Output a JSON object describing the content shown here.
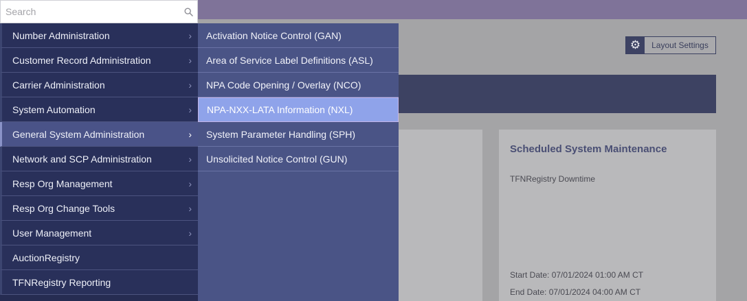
{
  "search": {
    "placeholder": "Search",
    "value": ""
  },
  "menu": {
    "items": [
      {
        "label": "Number Administration",
        "chevron": true
      },
      {
        "label": "Customer Record Administration",
        "chevron": true
      },
      {
        "label": "Carrier Administration",
        "chevron": true
      },
      {
        "label": "System Automation",
        "chevron": true
      },
      {
        "label": "General System Administration",
        "chevron": true,
        "active": true
      },
      {
        "label": "Network and SCP Administration",
        "chevron": true
      },
      {
        "label": "Resp Org Management",
        "chevron": true
      },
      {
        "label": "Resp Org Change Tools",
        "chevron": true
      },
      {
        "label": "User Management",
        "chevron": true
      },
      {
        "label": "AuctionRegistry",
        "chevron": false
      },
      {
        "label": "TFNRegistry Reporting",
        "chevron": false
      }
    ],
    "chevron_glyph": "›"
  },
  "submenu": {
    "items": [
      {
        "label": "Activation Notice Control (GAN)"
      },
      {
        "label": "Area of Service Label Definitions (ASL)"
      },
      {
        "label": "NPA Code Opening / Overlay (NCO)"
      },
      {
        "label": "NPA-NXX-LATA Information (NXL)",
        "highlighted": true
      },
      {
        "label": "System Parameter Handling (SPH)"
      },
      {
        "label": "Unsolicited Notice Control (GUN)"
      }
    ]
  },
  "header": {
    "layout_settings_label": "Layout Settings",
    "gear_glyph": "⚙"
  },
  "maintenance_card": {
    "title": "Scheduled System Maintenance",
    "subtitle": "TFNRegistry Downtime",
    "start_date": "Start Date: 07/01/2024 01:00 AM CT",
    "end_date": "End Date:  07/01/2024 04:00 AM CT"
  },
  "colors": {
    "topbar": "#7f7399",
    "menu_bg": "#262c52",
    "submenu_bg": "#4a5486",
    "highlight": "#8fa3ea"
  }
}
